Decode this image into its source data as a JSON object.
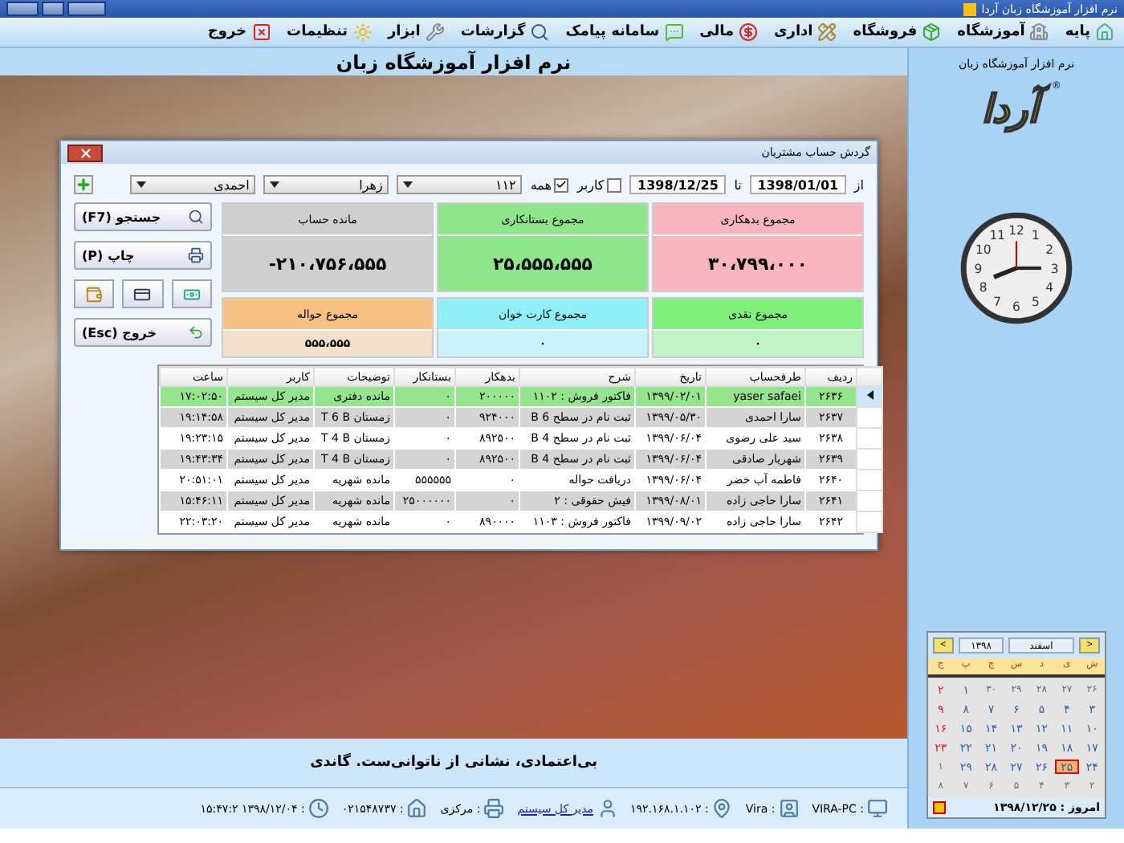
{
  "window": {
    "title": "نرم افزار آموزشگاه زبان آردا"
  },
  "menu": [
    {
      "label": "پایه"
    },
    {
      "label": "آموزشگاه"
    },
    {
      "label": "فروشگاه"
    },
    {
      "label": "اداری"
    },
    {
      "label": "مالی"
    },
    {
      "label": "سامانه پیامک"
    },
    {
      "label": "گزارشات"
    },
    {
      "label": "ابزار"
    },
    {
      "label": "تنظیمات"
    },
    {
      "label": "خروج"
    }
  ],
  "header": {
    "title": "نرم افزار آموزشگاه زبان"
  },
  "dialog": {
    "title": "گردش حساب مشتریان",
    "filters": {
      "from_label": "از",
      "from": "1398/01/01",
      "to_label": "تا",
      "to": "1398/12/25",
      "user_check": {
        "label": "کاربر",
        "checked": false
      },
      "all_check": {
        "label": "همه",
        "checked": true
      },
      "selects": [
        "۱۱۲",
        "زهرا",
        "احمدی"
      ]
    },
    "summary": [
      {
        "label": "مجموع بدهکاری",
        "value": "۳۰،۷۹۹،۰۰۰",
        "color": "#f9b6c0"
      },
      {
        "label": "مجموع بستانکاری",
        "value": "۲۵،۵۵۵،۵۵۵",
        "color": "#8fe58c"
      },
      {
        "label": "مانده حساب",
        "value": "-۲۱۰،۷۵۶،۵۵۵",
        "color": "#cfcfcf"
      }
    ],
    "payments": [
      {
        "label": "مجموع نقدی",
        "value": "۰",
        "color": "#7ff07a"
      },
      {
        "label": "مجموع کارت خوان",
        "value": "۰",
        "color": "#8ff0f7"
      },
      {
        "label": "مجموع حواله",
        "value": "۵۵۵،۵۵۵",
        "color": "#f8c184"
      }
    ],
    "buttons": [
      {
        "label": "جستجو (F7)",
        "kind": "search"
      },
      {
        "label": "چاپ (P)",
        "kind": "print"
      },
      {
        "label": "خروج (Esc)",
        "kind": "exit"
      }
    ],
    "table": {
      "columns": [
        "ردیف",
        "طرفحساب",
        "تاریخ",
        "شرح",
        "بدهکار",
        "بستانکار",
        "توضیحات",
        "کاربر",
        "ساعت"
      ],
      "rows": [
        {
          "selected": true,
          "cells": [
            "۲۶۳۶",
            "yaser safaei",
            "۱۳۹۹/۰۲/۰۱",
            "فاکتور فروش : ۱۱۰۲",
            "۲۰۰۰۰۰",
            "۰",
            "مانده دفتری",
            "مدیر کل سیستم",
            "۱۷:۰۲:۵۰"
          ]
        },
        {
          "selected": false,
          "cells": [
            "۲۶۳۷",
            "سارا احمدی",
            "۱۳۹۹/۰۵/۳۰",
            "ثبت نام در سطح B 6",
            "۹۲۴۰۰۰",
            "۰",
            "زمستان T 6 B",
            "مدیر کل سیستم",
            "۱۹:۱۴:۵۸"
          ]
        },
        {
          "selected": false,
          "cells": [
            "۲۶۳۸",
            "سید علی رضوی",
            "۱۳۹۹/۰۶/۰۴",
            "ثبت نام در سطح B 4",
            "۸۹۲۵۰۰",
            "۰",
            "زمستان T 4 B",
            "مدیر کل سیستم",
            "۱۹:۲۳:۱۵"
          ]
        },
        {
          "selected": false,
          "cells": [
            "۲۶۳۹",
            "شهریار صادقی",
            "۱۳۹۹/۰۶/۰۴",
            "ثبت نام در سطح B 4",
            "۸۹۲۵۰۰",
            "۰",
            "زمستان T 4 B",
            "مدیر کل سیستم",
            "۱۹:۴۳:۳۴"
          ]
        },
        {
          "selected": false,
          "cells": [
            "۲۶۴۰",
            "فاطمه آب خضر",
            "۱۳۹۹/۰۶/۰۴",
            "دریافت حواله",
            "۰",
            "۵۵۵۵۵۵",
            "مانده شهریه",
            "مدیر کل سیستم",
            "۲۰:۵۱:۰۱"
          ]
        },
        {
          "selected": false,
          "cells": [
            "۲۶۴۱",
            "سارا حاجی زاده",
            "۱۳۹۹/۰۸/۰۱",
            "فیش حقوقی : ۲",
            "۰",
            "۲۵۰۰۰۰۰۰",
            "مانده شهریه",
            "مدیر کل سیستم",
            "۱۵:۴۶:۱۱"
          ]
        },
        {
          "selected": false,
          "cells": [
            "۲۶۴۲",
            "سارا حاجی زاده",
            "۱۳۹۹/۰۹/۰۲",
            "فاکتور فروش : ۱۱۰۳",
            "۸۹۰۰۰۰",
            "۰",
            "مانده شهریه",
            "مدیر کل سیستم",
            "۲۲:۰۳:۲۰"
          ]
        }
      ]
    }
  },
  "quote": "بی‌اعتمادی، نشانی از ناتوانی‌ست. گاندی",
  "status_bar": [
    {
      "kind": "computer",
      "text": "VIRA-PC :"
    },
    {
      "kind": "user",
      "text": "Vira :"
    },
    {
      "kind": "ip",
      "text": "۱۹۲.۱۶۸.۱.۱۰۲ :"
    },
    {
      "kind": "operator",
      "text": "مدیر کل سیستم"
    },
    {
      "kind": "branch",
      "text": "مرکزی :"
    },
    {
      "kind": "phone",
      "text": "۰۲۱۵۴۸۷۳۷ :"
    },
    {
      "kind": "login",
      "text": "۱۵:۴۷:۲ ۱۳۹۸/۱۲/۰۴ :"
    }
  ],
  "side": {
    "app_name": "نرم افزار آموزشگاه زبان",
    "logo": "آردا",
    "logo_mark": "®",
    "clock_numerals": [
      "11",
      "12",
      "1",
      "10",
      "2",
      "9",
      "3",
      "8",
      "4",
      "7",
      "6",
      "5"
    ]
  },
  "calendar": {
    "month": "اسفند",
    "year": "۱۳۹۸",
    "prev": "<",
    "next": ">",
    "weekdays": [
      "ش",
      "ی",
      "د",
      "س",
      "چ",
      "پ",
      "ج"
    ],
    "days": [
      {
        "day": "۲۶",
        "muted": true,
        "holiday": false,
        "selected": false
      },
      {
        "day": "۲۷",
        "muted": true,
        "holiday": false,
        "selected": false
      },
      {
        "day": "۲۸",
        "muted": true,
        "holiday": false,
        "selected": false
      },
      {
        "day": "۲۹",
        "muted": true,
        "holiday": false,
        "selected": false
      },
      {
        "day": "۳۰",
        "muted": true,
        "holiday": false,
        "selected": false
      },
      {
        "day": "۱",
        "muted": false,
        "holiday": false,
        "selected": false
      },
      {
        "day": "۲",
        "muted": false,
        "holiday": true,
        "selected": false
      },
      {
        "day": "۳",
        "muted": false,
        "holiday": false,
        "selected": false
      },
      {
        "day": "۴",
        "muted": false,
        "holiday": false,
        "selected": false
      },
      {
        "day": "۵",
        "muted": false,
        "holiday": false,
        "selected": false
      },
      {
        "day": "۶",
        "muted": false,
        "holiday": false,
        "selected": false
      },
      {
        "day": "۷",
        "muted": false,
        "holiday": false,
        "selected": false
      },
      {
        "day": "۸",
        "muted": false,
        "holiday": false,
        "selected": false
      },
      {
        "day": "۹",
        "muted": false,
        "holiday": true,
        "selected": false
      },
      {
        "day": "۱۰",
        "muted": false,
        "holiday": false,
        "selected": false
      },
      {
        "day": "۱۱",
        "muted": false,
        "holiday": false,
        "selected": false
      },
      {
        "day": "۱۲",
        "muted": false,
        "holiday": false,
        "selected": false
      },
      {
        "day": "۱۳",
        "muted": false,
        "holiday": false,
        "selected": false
      },
      {
        "day": "۱۴",
        "muted": false,
        "holiday": false,
        "selected": false
      },
      {
        "day": "۱۵",
        "muted": false,
        "holiday": false,
        "selected": false
      },
      {
        "day": "۱۶",
        "muted": false,
        "holiday": true,
        "selected": false
      },
      {
        "day": "۱۷",
        "muted": false,
        "holiday": false,
        "selected": false
      },
      {
        "day": "۱۸",
        "muted": false,
        "holiday": false,
        "selected": false
      },
      {
        "day": "۱۹",
        "muted": false,
        "holiday": false,
        "selected": false
      },
      {
        "day": "۲۰",
        "muted": false,
        "holiday": false,
        "selected": false
      },
      {
        "day": "۲۱",
        "muted": false,
        "holiday": false,
        "selected": false
      },
      {
        "day": "۲۲",
        "muted": false,
        "holiday": false,
        "selected": false
      },
      {
        "day": "۲۳",
        "muted": false,
        "holiday": true,
        "selected": false
      },
      {
        "day": "۲۴",
        "muted": false,
        "holiday": false,
        "selected": false
      },
      {
        "day": "۲۵",
        "muted": false,
        "holiday": false,
        "selected": true
      },
      {
        "day": "۲۶",
        "muted": false,
        "holiday": false,
        "selected": false
      },
      {
        "day": "۲۷",
        "muted": false,
        "holiday": false,
        "selected": false
      },
      {
        "day": "۲۸",
        "muted": false,
        "holiday": false,
        "selected": false
      },
      {
        "day": "۲۹",
        "muted": false,
        "holiday": false,
        "selected": false
      },
      {
        "day": "۱",
        "muted": true,
        "holiday": false,
        "selected": false
      },
      {
        "day": "۲",
        "muted": true,
        "holiday": false,
        "selected": false
      },
      {
        "day": "۳",
        "muted": true,
        "holiday": false,
        "selected": false
      },
      {
        "day": "۴",
        "muted": true,
        "holiday": false,
        "selected": false
      },
      {
        "day": "۵",
        "muted": true,
        "holiday": false,
        "selected": false
      },
      {
        "day": "۶",
        "muted": true,
        "holiday": false,
        "selected": false
      },
      {
        "day": "۷",
        "muted": true,
        "holiday": false,
        "selected": false
      },
      {
        "day": "۸",
        "muted": true,
        "holiday": false,
        "selected": false
      }
    ],
    "today": "امروز : ۱۳۹۸/۱۲/۲۵"
  }
}
